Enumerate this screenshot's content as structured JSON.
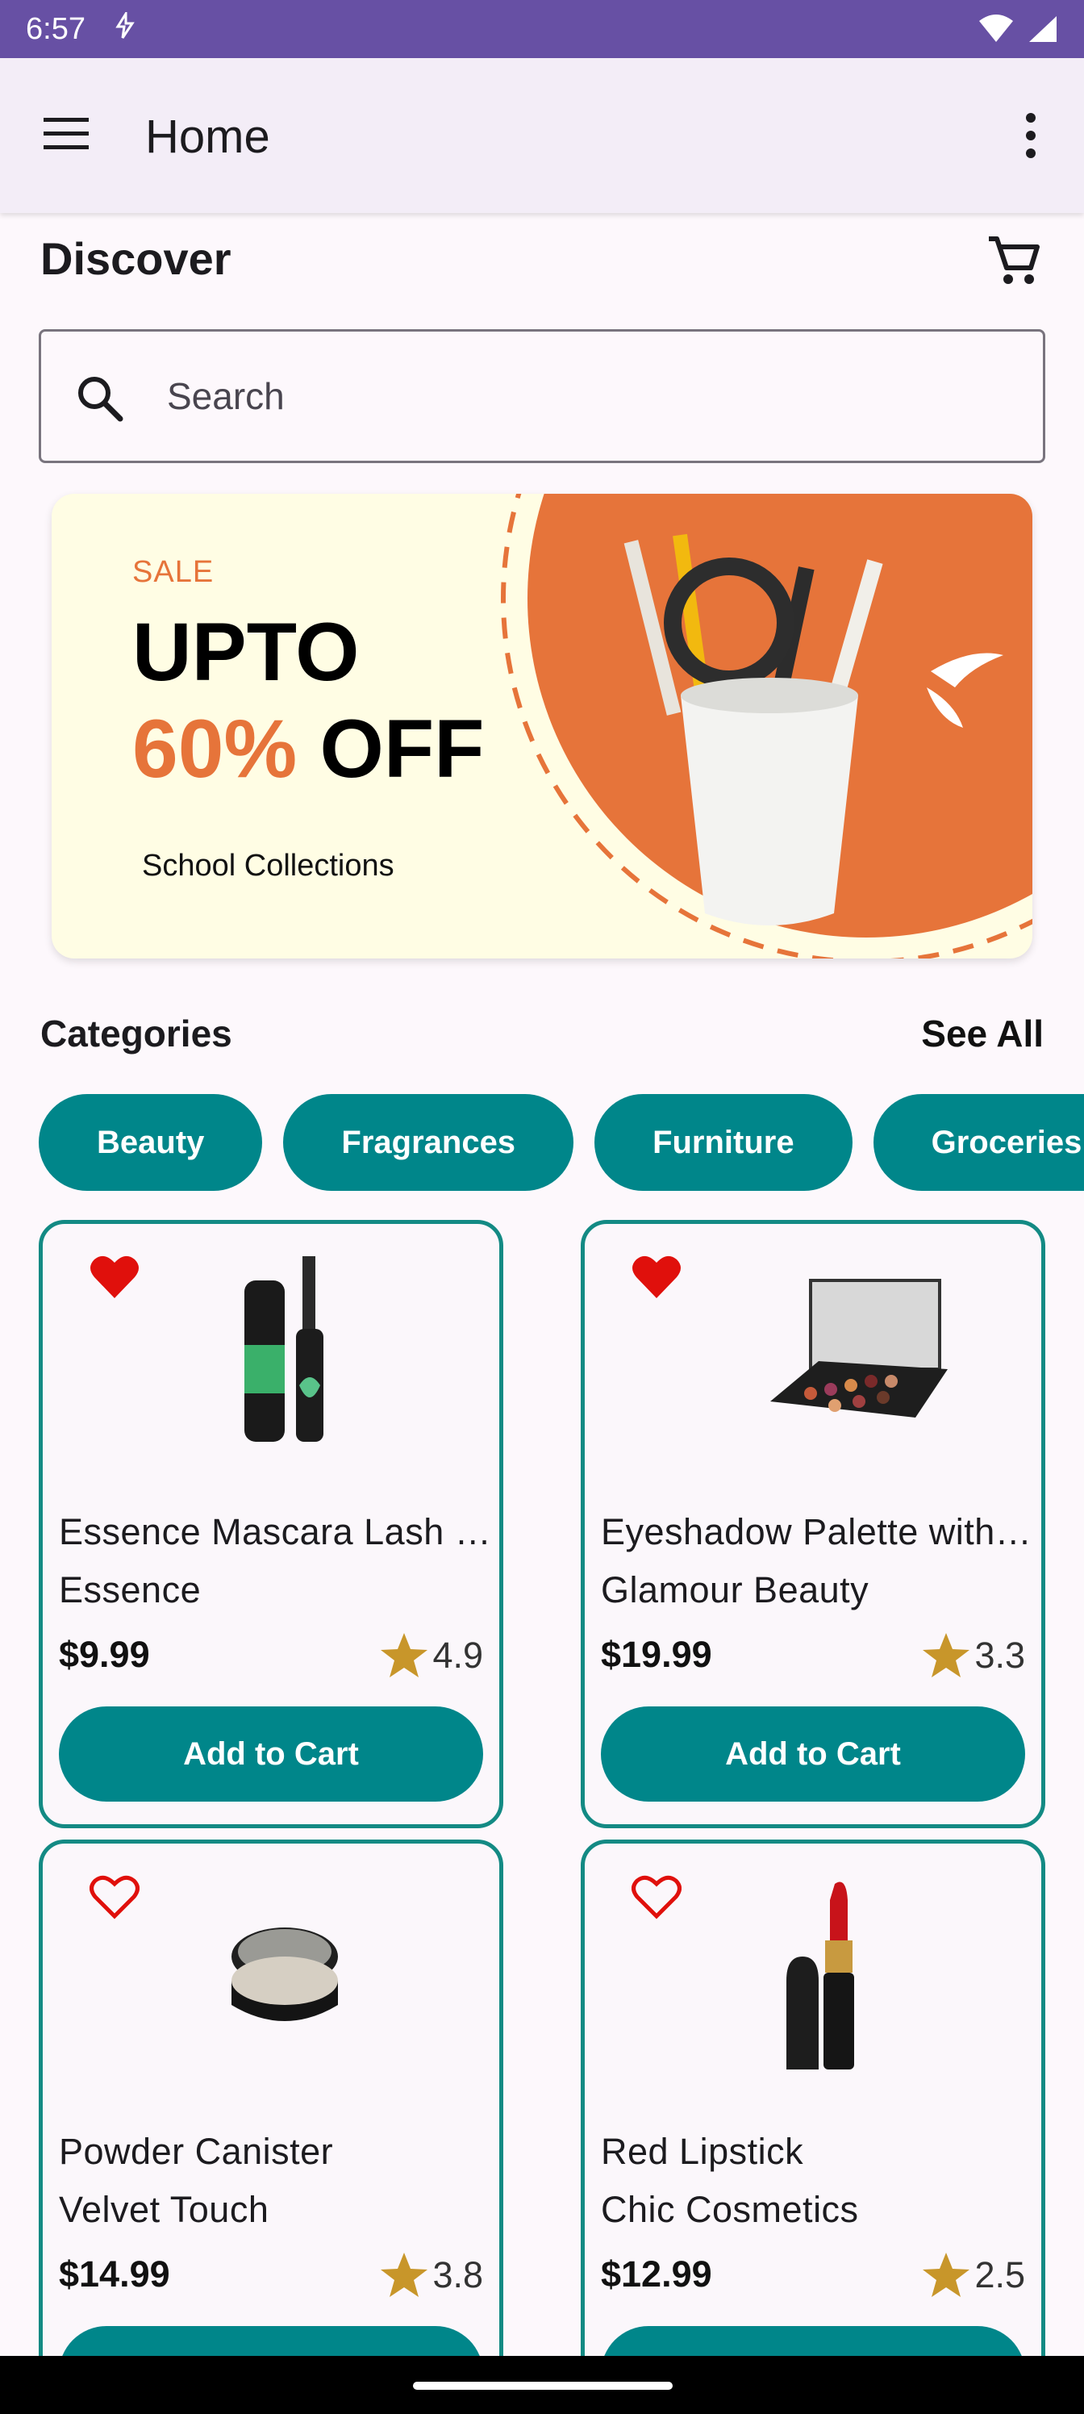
{
  "status_bar": {
    "time": "6:57"
  },
  "app_bar": {
    "title": "Home"
  },
  "discover": {
    "title": "Discover"
  },
  "search": {
    "placeholder": "Search"
  },
  "banner": {
    "sale": "SALE",
    "upto": "UPTO",
    "percent": "60%",
    "off": "OFF",
    "collection": "School Collections"
  },
  "categories": {
    "title": "Categories",
    "see_all": "See All",
    "items": [
      "Beauty",
      "Fragrances",
      "Furniture",
      "Groceries"
    ]
  },
  "products": [
    {
      "name": "Essence Mascara Lash Princess",
      "brand": "Essence",
      "price": "$9.99",
      "rating": "4.9",
      "favorite": true,
      "button": "Add to Cart"
    },
    {
      "name": "Eyeshadow Palette with Mirror",
      "brand": "Glamour Beauty",
      "price": "$19.99",
      "rating": "3.3",
      "favorite": true,
      "button": "Add to Cart"
    },
    {
      "name": "Powder Canister",
      "brand": "Velvet Touch",
      "price": "$14.99",
      "rating": "3.8",
      "favorite": false,
      "button": "Add to Cart"
    },
    {
      "name": "Red Lipstick",
      "brand": "Chic Cosmetics",
      "price": "$12.99",
      "rating": "2.5",
      "favorite": false,
      "button": "Add to Cart"
    }
  ],
  "colors": {
    "status_bar": "#6750a4",
    "accent": "#00868a",
    "card_border": "#138a84",
    "sale_orange": "#e6743a",
    "heart_red": "#e0100c",
    "star_gold": "#c8962a"
  },
  "icons": {
    "menu": "menu-icon",
    "more": "more-vert-icon",
    "cart": "shopping-cart-icon",
    "search": "search-icon",
    "heart": "heart-icon",
    "star": "star-icon"
  }
}
